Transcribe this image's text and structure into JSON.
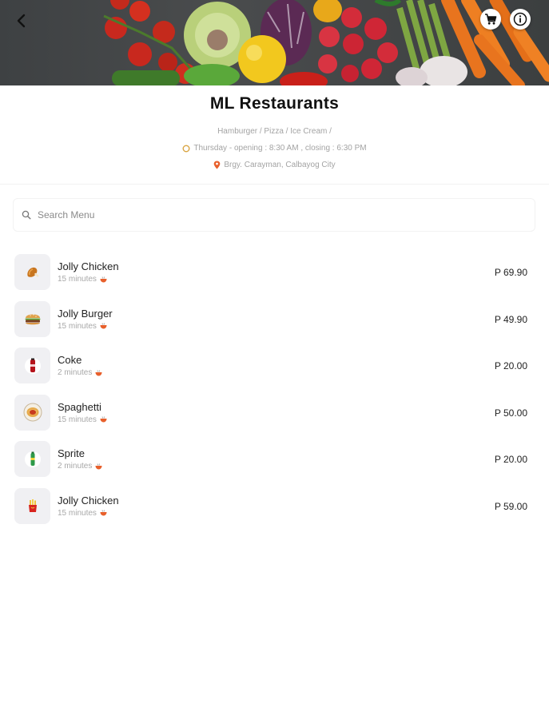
{
  "header": {
    "restaurant_name": "ML Restaurants",
    "categories": "Hamburger / Pizza / Ice Cream /",
    "hours": "Thursday -  opening : 8:30 AM , closing : 6:30 PM",
    "address": "Brgy. Carayman, Calbayog City"
  },
  "icons": {
    "back": "chevron-left-icon",
    "cart": "cart-icon",
    "info": "info-icon",
    "clock": "clock-icon",
    "location": "location-pin-icon",
    "search": "search-icon",
    "prep": "bowl-icon"
  },
  "colors": {
    "accent": "#e8602c",
    "clock": "#d9a441"
  },
  "search": {
    "placeholder": "Search Menu"
  },
  "menu": {
    "items": [
      {
        "name": "Jolly Chicken",
        "time": "15 minutes",
        "price": "P 69.90",
        "thumb": "chicken"
      },
      {
        "name": "Jolly Burger",
        "time": "15 minutes",
        "price": "P 49.90",
        "thumb": "burger"
      },
      {
        "name": "Coke",
        "time": "2 minutes",
        "price": "P 20.00",
        "thumb": "coke"
      },
      {
        "name": "Spaghetti",
        "time": "15 minutes",
        "price": "P 50.00",
        "thumb": "spaghetti"
      },
      {
        "name": "Sprite",
        "time": "2 minutes",
        "price": "P 20.00",
        "thumb": "sprite"
      },
      {
        "name": "Jolly Chicken",
        "time": "15 minutes",
        "price": "P 59.00",
        "thumb": "fries"
      }
    ]
  }
}
